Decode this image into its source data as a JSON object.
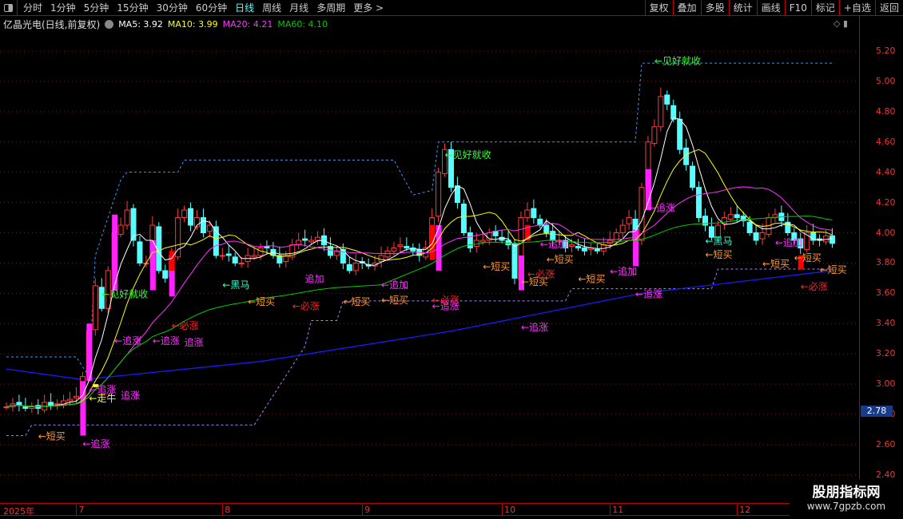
{
  "toolbar": {
    "periods": [
      "分时",
      "1分钟",
      "5分钟",
      "15分钟",
      "30分钟",
      "60分钟",
      "日线",
      "周线",
      "月线",
      "多周期",
      "更多 >"
    ],
    "active": "日线",
    "buttons": [
      "复权",
      "叠加",
      "多股",
      "统计",
      "画线",
      "F10",
      "标记",
      "+自选",
      "返回"
    ]
  },
  "info": {
    "title": "亿晶光电(日线,前复权)",
    "ma5": "MA5: 3.92",
    "ma10": "MA10: 3.99",
    "ma20": "MA20: 4.21",
    "ma60": "MA60: 4.10"
  },
  "colors": {
    "up": "#ff3b3b",
    "down": "#55ffff",
    "ma5": "#ffffff",
    "ma10": "#ffff00",
    "ma20": "#ff33ff",
    "ma60": "#00cc00",
    "long_ma": "#1a1aff",
    "upper_band": "#3399ff",
    "lower_band": "#b080ff",
    "grid": "#b00000"
  },
  "price_tag": "2.78",
  "watermark": {
    "line1": "股朋指标网",
    "line2": "www.7gpzb.com"
  },
  "chart_data": {
    "type": "candlestick",
    "ylim": [
      2.4,
      5.25
    ],
    "yticks": [
      "5.20",
      "5.00",
      "4.80",
      "4.60",
      "4.40",
      "4.20",
      "4.00",
      "3.80",
      "3.60",
      "3.40",
      "3.20",
      "3.00",
      "2.80",
      "2.60",
      "2.40"
    ],
    "xticks": [
      {
        "label": "2025年",
        "index": 0
      },
      {
        "label": "7",
        "index": 11
      },
      {
        "label": "8",
        "index": 34
      },
      {
        "label": "9",
        "index": 56
      },
      {
        "label": "10",
        "index": 78
      },
      {
        "label": "11",
        "index": 95
      },
      {
        "label": "12",
        "index": 115
      }
    ],
    "closes": [
      2.85,
      2.87,
      2.86,
      2.84,
      2.85,
      2.84,
      2.88,
      2.86,
      2.87,
      2.89,
      2.9,
      2.92,
      3.05,
      3.35,
      3.65,
      3.5,
      3.75,
      4.0,
      4.05,
      4.15,
      3.95,
      3.8,
      3.8,
      4.05,
      3.75,
      3.7,
      3.85,
      4.1,
      4.15,
      4.05,
      4.1,
      4.0,
      4.05,
      3.85,
      3.85,
      3.85,
      3.8,
      3.8,
      3.85,
      3.85,
      3.9,
      3.9,
      3.85,
      3.8,
      3.85,
      3.92,
      3.95,
      3.95,
      3.95,
      3.97,
      3.92,
      3.85,
      3.88,
      3.8,
      3.75,
      3.8,
      3.8,
      3.78,
      3.8,
      3.85,
      3.88,
      3.9,
      3.92,
      3.9,
      3.88,
      3.85,
      3.9,
      4.1,
      4.4,
      4.55,
      4.3,
      4.2,
      4.0,
      3.9,
      3.95,
      3.95,
      4.0,
      3.98,
      3.95,
      3.92,
      3.7,
      4.1,
      4.15,
      4.1,
      4.05,
      4.0,
      3.95,
      3.95,
      3.9,
      3.92,
      3.9,
      3.88,
      3.9,
      3.88,
      3.92,
      3.95,
      4.0,
      4.05,
      4.1,
      3.95,
      4.3,
      4.6,
      4.7,
      4.9,
      4.85,
      4.75,
      4.55,
      4.45,
      4.3,
      4.1,
      4.05,
      3.97,
      4.05,
      4.1,
      4.12,
      4.1,
      4.08,
      4.0,
      3.95,
      4.0,
      4.1,
      4.12,
      4.08,
      4.0,
      3.95,
      3.9,
      4.0,
      3.95,
      3.95,
      3.98,
      3.93
    ],
    "signal_bars": [
      [
        12,
        2.66,
        3.02,
        "#ff22ff"
      ],
      [
        13,
        3.02,
        3.4,
        "#ff22ff"
      ],
      [
        14,
        2.98,
        3.0,
        "#ffff00"
      ],
      [
        17,
        3.62,
        4.12,
        "#ff22ff"
      ],
      [
        23,
        3.62,
        3.95,
        "#ff22ff"
      ],
      [
        26,
        3.58,
        3.75,
        "#ff22ff"
      ],
      [
        26,
        3.75,
        3.88,
        "#ff0000"
      ],
      [
        67,
        3.82,
        4.05,
        "#ff0000"
      ],
      [
        68,
        3.75,
        4.05,
        "#ff22ff"
      ],
      [
        81,
        3.62,
        3.85,
        "#ff22ff"
      ],
      [
        82,
        3.95,
        4.05,
        "#ff0000"
      ],
      [
        99,
        3.78,
        4.02,
        "#ff22ff"
      ],
      [
        101,
        4.15,
        4.42,
        "#ff22ff"
      ],
      [
        125,
        3.76,
        3.85,
        "#ff0000"
      ]
    ],
    "upper_band": [
      [
        0,
        3.18
      ],
      [
        11,
        3.18
      ],
      [
        13,
        3.05
      ],
      [
        14,
        3.85
      ],
      [
        18,
        4.35
      ],
      [
        19,
        4.4
      ],
      [
        27,
        4.4
      ],
      [
        28,
        4.48
      ],
      [
        61,
        4.48
      ],
      [
        64,
        4.25
      ],
      [
        67,
        4.28
      ],
      [
        68,
        4.6
      ],
      [
        99,
        4.6
      ],
      [
        100,
        5.12
      ],
      [
        130,
        5.12
      ]
    ],
    "lower_band": [
      [
        0,
        2.66
      ],
      [
        3,
        2.66
      ],
      [
        4,
        2.73
      ],
      [
        39,
        2.73
      ],
      [
        47,
        3.25
      ],
      [
        48,
        3.42
      ],
      [
        52,
        3.42
      ],
      [
        53,
        3.55
      ],
      [
        88,
        3.55
      ],
      [
        89,
        3.63
      ],
      [
        111,
        3.63
      ],
      [
        112,
        3.76
      ],
      [
        130,
        3.76
      ]
    ],
    "long_ma": [
      [
        0,
        3.1
      ],
      [
        12,
        3.03
      ],
      [
        40,
        3.15
      ],
      [
        70,
        3.35
      ],
      [
        100,
        3.6
      ],
      [
        130,
        3.75
      ]
    ],
    "annotations": [
      {
        "i": 102,
        "p": 5.14,
        "t": "←见好就收",
        "c": "#33ff33"
      },
      {
        "i": 69,
        "p": 4.52,
        "t": "←见好就收",
        "c": "#33ff33"
      },
      {
        "i": 15,
        "p": 3.6,
        "t": "←见好就收",
        "c": "#33ff33"
      },
      {
        "i": 12,
        "p": 2.61,
        "t": "←追涨",
        "c": "#ff33ff"
      },
      {
        "i": 5,
        "p": 2.66,
        "t": "←短买",
        "c": "#ff9933"
      },
      {
        "i": 17,
        "p": 3.29,
        "t": "←追涨",
        "c": "#ff33ff"
      },
      {
        "i": 23,
        "p": 3.29,
        "t": "←追涨",
        "c": "#ff33ff"
      },
      {
        "i": 28,
        "p": 3.28,
        "t": "追涨",
        "c": "#ff33ff"
      },
      {
        "i": 26,
        "p": 3.39,
        "t": "←必涨",
        "c": "#ff2222"
      },
      {
        "i": 13,
        "p": 2.97,
        "t": "←追涨",
        "c": "#ff33ff"
      },
      {
        "i": 13,
        "p": 2.91,
        "t": "←走牛",
        "c": "#ffff00"
      },
      {
        "i": 18,
        "p": 2.93,
        "t": "追涨",
        "c": "#ff33ff"
      },
      {
        "i": 34,
        "p": 3.66,
        "t": "←黑马",
        "c": "#33ffcc"
      },
      {
        "i": 38,
        "p": 3.55,
        "t": "←短买",
        "c": "#ff9933"
      },
      {
        "i": 47,
        "p": 3.7,
        "t": "追加",
        "c": "#ff33ff"
      },
      {
        "i": 45,
        "p": 3.52,
        "t": "←必涨",
        "c": "#ff2222"
      },
      {
        "i": 53,
        "p": 3.55,
        "t": "←短买",
        "c": "#ff9933"
      },
      {
        "i": 59,
        "p": 3.56,
        "t": "←短买",
        "c": "#ff9933"
      },
      {
        "i": 59,
        "p": 3.66,
        "t": "←追加",
        "c": "#ff33ff"
      },
      {
        "i": 67,
        "p": 3.56,
        "t": "←必涨",
        "c": "#ff2222"
      },
      {
        "i": 67,
        "p": 3.52,
        "t": "←追涨",
        "c": "#ff33ff"
      },
      {
        "i": 75,
        "p": 3.78,
        "t": "←短买",
        "c": "#ff9933"
      },
      {
        "i": 82,
        "p": 3.73,
        "t": "←必涨",
        "c": "#ff2222"
      },
      {
        "i": 81,
        "p": 3.68,
        "t": "←短买",
        "c": "#ff9933"
      },
      {
        "i": 81,
        "p": 3.38,
        "t": "←追涨",
        "c": "#ff33ff"
      },
      {
        "i": 85,
        "p": 3.83,
        "t": "←短买",
        "c": "#ff9933"
      },
      {
        "i": 84,
        "p": 3.93,
        "t": "←追加",
        "c": "#ff33ff"
      },
      {
        "i": 90,
        "p": 3.7,
        "t": "←短买",
        "c": "#ff9933"
      },
      {
        "i": 95,
        "p": 3.75,
        "t": "←追加",
        "c": "#ff33ff"
      },
      {
        "i": 101,
        "p": 4.17,
        "t": "←追涨",
        "c": "#ff33ff"
      },
      {
        "i": 99,
        "p": 3.6,
        "t": "←追涨",
        "c": "#ff33ff"
      },
      {
        "i": 110,
        "p": 3.95,
        "t": "←黑马",
        "c": "#33ffcc"
      },
      {
        "i": 110,
        "p": 3.86,
        "t": "←短买",
        "c": "#ff9933"
      },
      {
        "i": 119,
        "p": 3.8,
        "t": "←短买",
        "c": "#ff9933"
      },
      {
        "i": 121,
        "p": 3.94,
        "t": "←追加",
        "c": "#ff33ff"
      },
      {
        "i": 124,
        "p": 3.84,
        "t": "←短买",
        "c": "#ff9933"
      },
      {
        "i": 128,
        "p": 3.76,
        "t": "←短买",
        "c": "#ff9933"
      },
      {
        "i": 125,
        "p": 3.65,
        "t": "←必涨",
        "c": "#ff2222"
      }
    ]
  }
}
